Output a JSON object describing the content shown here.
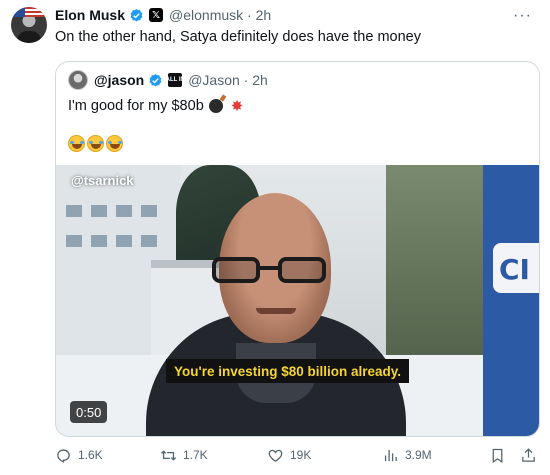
{
  "post": {
    "author_name": "Elon Musk",
    "handle": "@elonmusk · 2h",
    "more": "···",
    "text": "On the other hand, Satya definitely does have the money"
  },
  "quote": {
    "author_name": "@jason",
    "badge_text": "ALL IN",
    "handle": "@Jason · 2h",
    "text": "I'm good for my $80b",
    "video": {
      "watermark": "@tsarnick",
      "caption": "You're investing $80 billion already.",
      "duration": "0:50"
    }
  },
  "actions": {
    "replies": "1.6K",
    "reposts": "1.7K",
    "likes": "19K",
    "views": "3.9M"
  },
  "colors": {
    "text": "#0f1419",
    "muted": "#536471",
    "verified": "#1d9bf0",
    "caption": "#f5d531"
  },
  "icons": [
    "verified-icon",
    "x-affiliate-icon",
    "more-icon",
    "bomb-icon",
    "collision-icon",
    "laughing-icon",
    "reply-icon",
    "repost-icon",
    "like-icon",
    "views-icon",
    "bookmark-icon",
    "share-icon"
  ]
}
